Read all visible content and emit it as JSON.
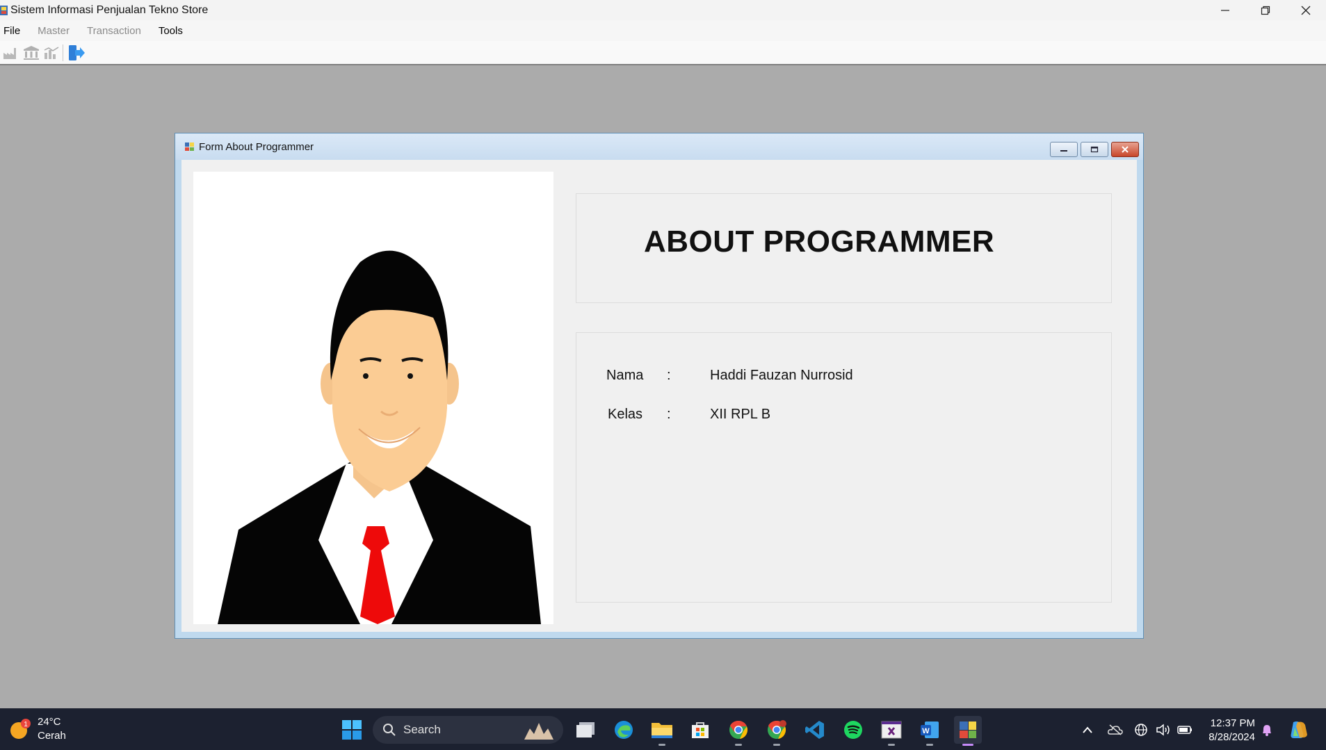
{
  "window": {
    "title": "Sistem Informasi Penjualan Tekno Store",
    "controls": {
      "minimize": "—",
      "restore": "❐",
      "close": "✕"
    }
  },
  "menu": [
    {
      "label": "File",
      "enabled": true
    },
    {
      "label": "Master",
      "enabled": false
    },
    {
      "label": "Transaction",
      "enabled": false
    },
    {
      "label": "Tools",
      "enabled": true
    }
  ],
  "toolbar": {
    "buttons": [
      {
        "icon": "factory-icon",
        "enabled": false
      },
      {
        "icon": "bank-icon",
        "enabled": false
      },
      {
        "icon": "chart-icon",
        "enabled": false
      },
      {
        "icon": "logout-icon",
        "enabled": true
      }
    ]
  },
  "child_form": {
    "title": "Form About Programmer",
    "heading": "ABOUT PROGRAMMER",
    "fields": [
      {
        "label": "Nama",
        "separator": ":",
        "value": "Haddi Fauzan Nurrosid"
      },
      {
        "label": "Kelas",
        "separator": ":",
        "value": "XII RPL B"
      }
    ]
  },
  "taskbar": {
    "weather": {
      "temperature": "24°C",
      "condition": "Cerah",
      "badge": "1"
    },
    "search_placeholder": "Search",
    "apps": [
      "windows-start-icon",
      "task-view-icon",
      "edge-icon",
      "file-explorer-icon",
      "store-icon",
      "chrome-icon",
      "chrome-profile-icon",
      "vscode-icon",
      "spotify-icon",
      "visual-studio-icon",
      "word-icon",
      "winforms-app-icon"
    ],
    "clock": {
      "time": "12:37 PM",
      "date": "8/28/2024"
    }
  },
  "colors": {
    "titlebar": "#f3f3f3",
    "workspace": "#ababab",
    "taskbar": "#1c2130",
    "accent": "#0067c0"
  }
}
